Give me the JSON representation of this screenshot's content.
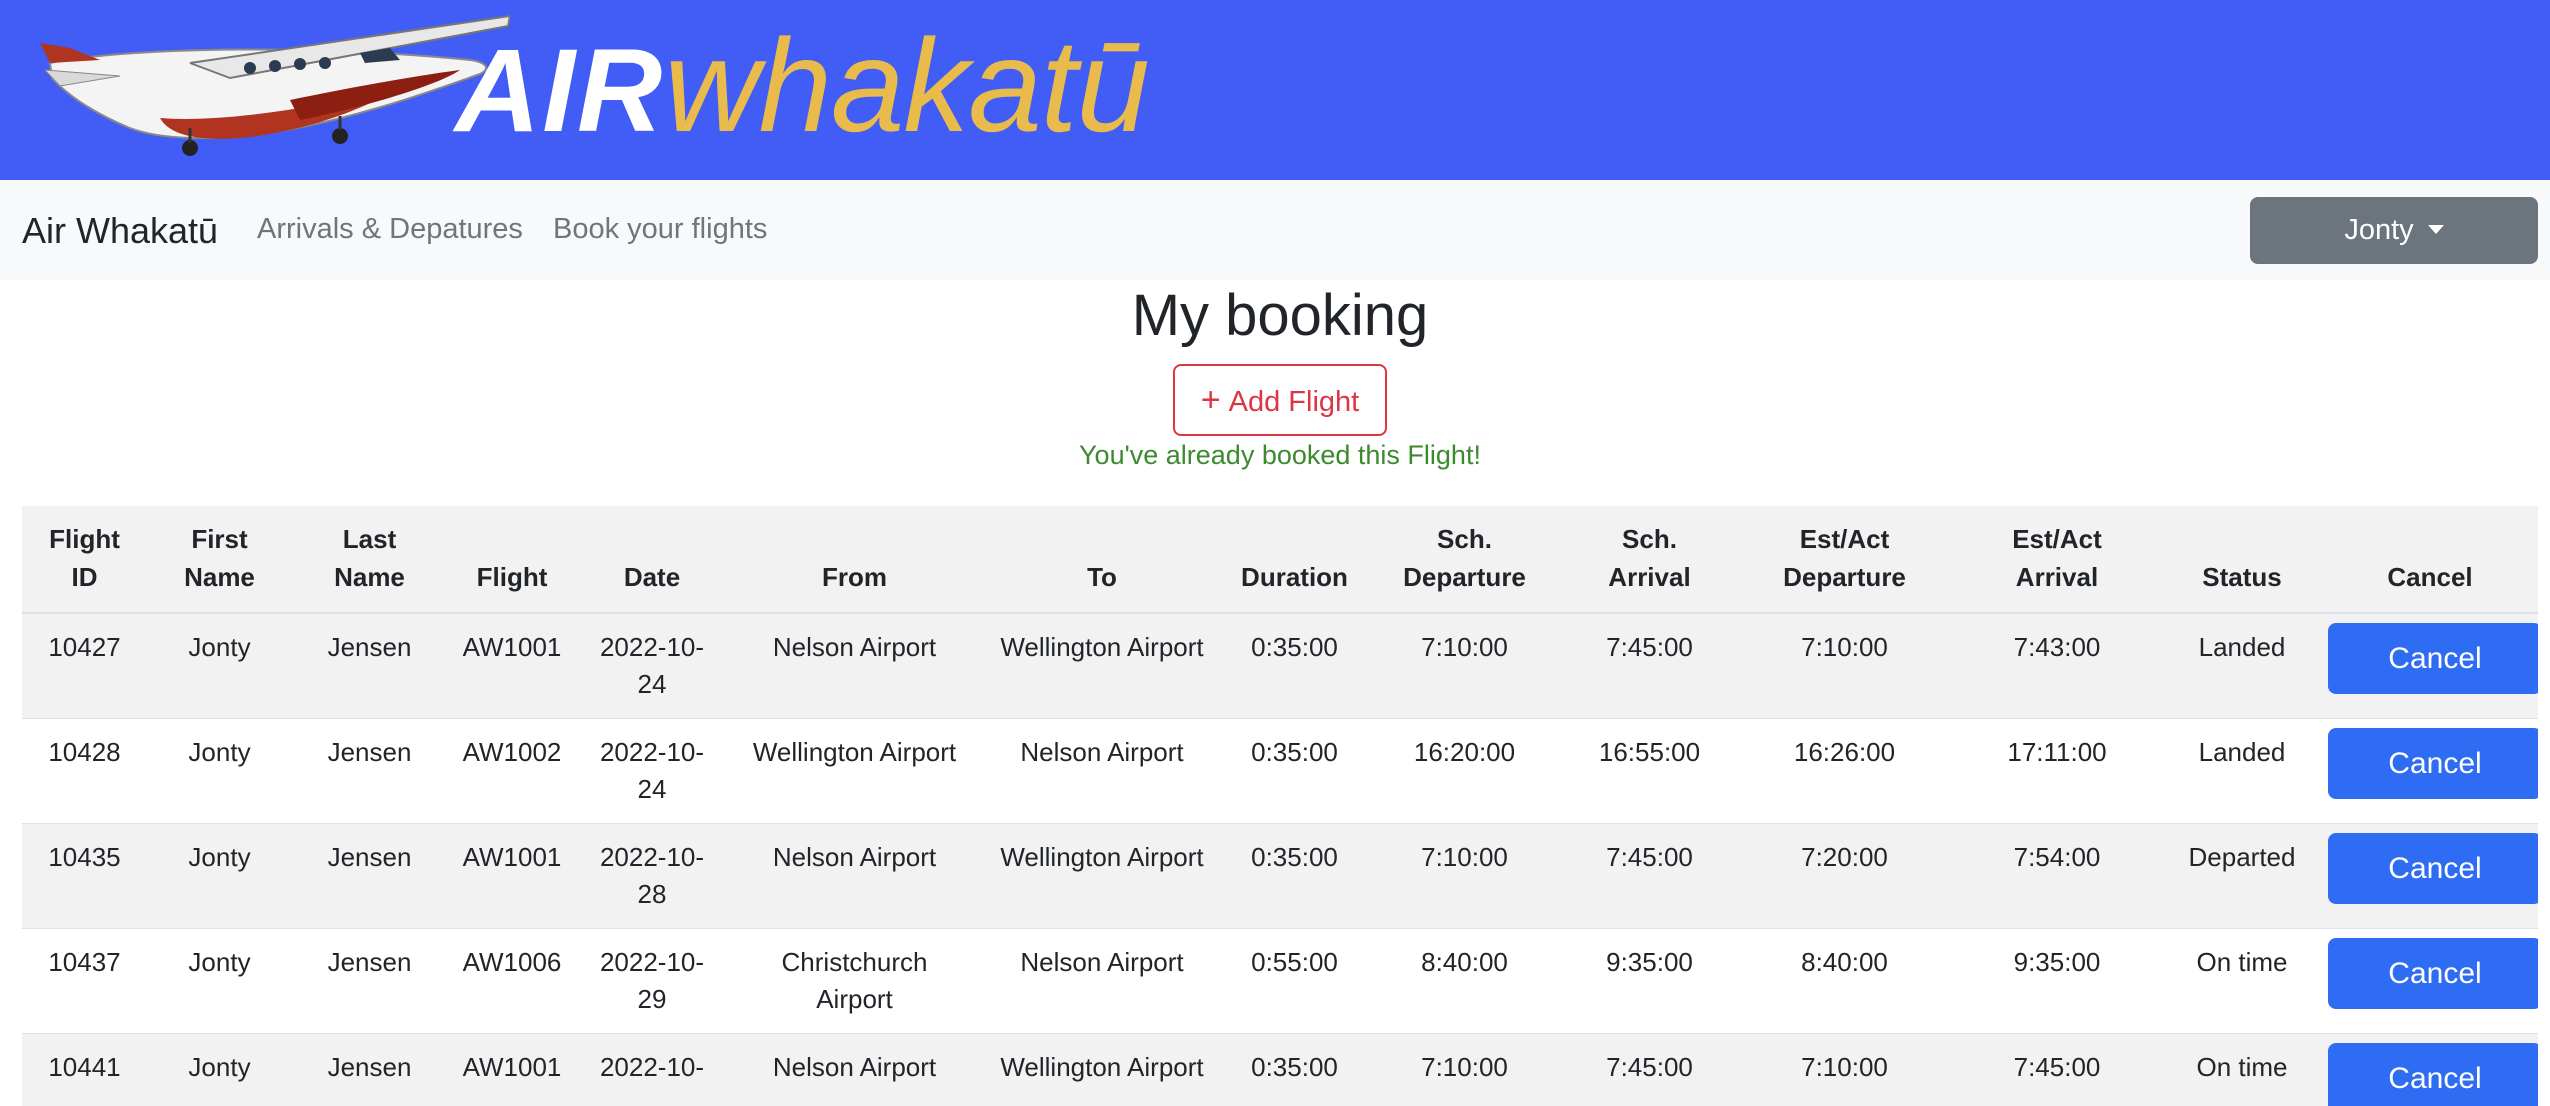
{
  "banner": {
    "logo_air": "AIR",
    "logo_whakatu": "whakatū",
    "colors": {
      "background": "#425df6",
      "air_text": "#ffffff",
      "whakatu_text": "#e9bb4a"
    }
  },
  "navbar": {
    "brand": "Air Whakatū",
    "links": [
      "Arrivals & Depatures",
      "Book your flights"
    ],
    "user_menu": "Jonty"
  },
  "main": {
    "title": "My booking",
    "add_button": "Add Flight",
    "add_icon": "+",
    "message": "You've already booked this Flight!"
  },
  "table": {
    "headers": [
      [
        "Flight",
        "ID"
      ],
      [
        "First",
        "Name"
      ],
      [
        "Last",
        "Name"
      ],
      [
        "",
        "Flight"
      ],
      [
        "",
        "Date"
      ],
      [
        "",
        "From"
      ],
      [
        "",
        "To"
      ],
      [
        "",
        "Duration"
      ],
      [
        "Sch.",
        "Departure"
      ],
      [
        "Sch.",
        "Arrival"
      ],
      [
        "Est/Act",
        "Departure"
      ],
      [
        "Est/Act",
        "Arrival"
      ],
      [
        "",
        "Status"
      ],
      [
        "",
        "Cancel"
      ]
    ],
    "rows": [
      {
        "id": "10427",
        "first": "Jonty",
        "last": "Jensen",
        "flight": "AW1001",
        "date": [
          "2022-10-",
          "24"
        ],
        "from": [
          "Nelson Airport"
        ],
        "to": "Wellington Airport",
        "duration": "0:35:00",
        "sch_dep": "7:10:00",
        "sch_arr": "7:45:00",
        "est_dep": "7:10:00",
        "est_arr": "7:43:00",
        "status": "Landed",
        "cancel": "Cancel"
      },
      {
        "id": "10428",
        "first": "Jonty",
        "last": "Jensen",
        "flight": "AW1002",
        "date": [
          "2022-10-",
          "24"
        ],
        "from": [
          "Wellington Airport"
        ],
        "to": "Nelson Airport",
        "duration": "0:35:00",
        "sch_dep": "16:20:00",
        "sch_arr": "16:55:00",
        "est_dep": "16:26:00",
        "est_arr": "17:11:00",
        "status": "Landed",
        "cancel": "Cancel"
      },
      {
        "id": "10435",
        "first": "Jonty",
        "last": "Jensen",
        "flight": "AW1001",
        "date": [
          "2022-10-",
          "28"
        ],
        "from": [
          "Nelson Airport"
        ],
        "to": "Wellington Airport",
        "duration": "0:35:00",
        "sch_dep": "7:10:00",
        "sch_arr": "7:45:00",
        "est_dep": "7:20:00",
        "est_arr": "7:54:00",
        "status": "Departed",
        "cancel": "Cancel"
      },
      {
        "id": "10437",
        "first": "Jonty",
        "last": "Jensen",
        "flight": "AW1006",
        "date": [
          "2022-10-",
          "29"
        ],
        "from": [
          "Christchurch",
          "Airport"
        ],
        "to": "Nelson Airport",
        "duration": "0:55:00",
        "sch_dep": "8:40:00",
        "sch_arr": "9:35:00",
        "est_dep": "8:40:00",
        "est_arr": "9:35:00",
        "status": "On time",
        "cancel": "Cancel"
      },
      {
        "id": "10441",
        "first": "Jonty",
        "last": "Jensen",
        "flight": "AW1001",
        "date": [
          "2022-10-",
          ""
        ],
        "from": [
          "Nelson Airport"
        ],
        "to": "Wellington Airport",
        "duration": "0:35:00",
        "sch_dep": "7:10:00",
        "sch_arr": "7:45:00",
        "est_dep": "7:10:00",
        "est_arr": "7:45:00",
        "status": "On time",
        "cancel": "Cancel"
      }
    ]
  }
}
